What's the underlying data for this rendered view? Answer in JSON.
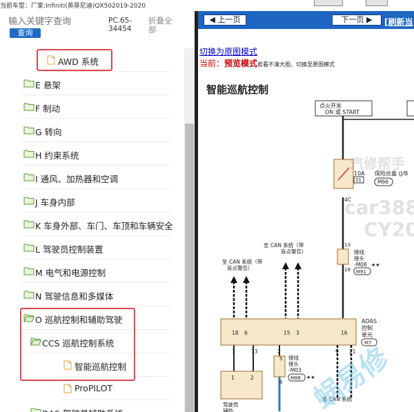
{
  "header": {
    "car_model": "当前车型：厂家:Infiniti(英菲尼迪)QX502019-2020"
  },
  "search": {
    "placeholder": "输入关键字查询",
    "button_label": "查询",
    "pc_code": "PC.65-34454",
    "collapse_all": "折叠全部"
  },
  "tree": {
    "items": [
      {
        "label": "AWD 系统",
        "icon": "document-icon",
        "type": "page"
      },
      {
        "label": "E 悬架",
        "icon": "folder-icon",
        "type": "folder"
      },
      {
        "label": "F 制动",
        "icon": "folder-icon",
        "type": "folder"
      },
      {
        "label": "G 转向",
        "icon": "folder-icon",
        "type": "folder"
      },
      {
        "label": "H 约束系统",
        "icon": "folder-icon",
        "type": "folder"
      },
      {
        "label": "I 通风、加热器和空调",
        "icon": "folder-icon",
        "type": "folder"
      },
      {
        "label": "J 车身内部",
        "icon": "folder-icon",
        "type": "folder"
      },
      {
        "label": "K 车身外部、车门、车顶和车辆安全",
        "icon": "folder-icon",
        "type": "folder"
      },
      {
        "label": "L 驾驶员控制装置",
        "icon": "folder-icon",
        "type": "folder"
      },
      {
        "label": "M 电气和电源控制",
        "icon": "folder-icon",
        "type": "folder"
      },
      {
        "label": "N 驾驶信息和多媒体",
        "icon": "folder-icon",
        "type": "folder"
      },
      {
        "label": "O 巡航控制和辅助驾驶",
        "icon": "folder-open-icon",
        "type": "folder-open"
      },
      {
        "label": "CCS 巡航控制系统",
        "icon": "folder-open-icon",
        "type": "folder-open"
      },
      {
        "label": "智能巡航控制",
        "icon": "document-icon",
        "type": "page"
      },
      {
        "label": "ProPILOT",
        "icon": "document-icon",
        "type": "page"
      },
      {
        "label": "DAS 驾驶员辅助系统",
        "icon": "folder-icon",
        "type": "folder"
      }
    ]
  },
  "viewer": {
    "prev_label": "上一页",
    "next_label": "下一页",
    "refresh_label": "[刷新当",
    "switch_link": "切换为原图模式",
    "current_prefix": "当前：",
    "current_mode": "预览模式",
    "current_hint": "若看不清大图，切换至原图模式",
    "doc_title": "智能巡航控制"
  },
  "diagram": {
    "ignition_label_1": "点火开关",
    "ignition_label_2": "ON 或 START",
    "fuse_amp": "10A",
    "fuse_no": "31",
    "fuse_box_1": "保险丝盒 (J/B",
    "fuse_box_2": "M66",
    "pin_4c": "4C",
    "can_top_1": "至 CAN 系统（带",
    "can_top_2": "盲点警告）",
    "can_left_1": "至 CAN 系统（带",
    "can_left_2": "盲点警告）",
    "junction_1": "接线",
    "junction_2": "接头",
    "junction_m08": "-M08",
    "junction_m91": "M91",
    "pin_13": "13",
    "pin_18": "18",
    "stars": "★★",
    "top_pins": [
      "18",
      "6",
      "15",
      "3",
      "16"
    ],
    "bottom_pins": [
      "1",
      "13",
      "2",
      "9",
      "21"
    ],
    "adas_1": "ADAS",
    "adas_2": "控制",
    "adas_3": "单元",
    "adas_conn": "M7",
    "junction_m03": "-M03",
    "junction_m86": "M86",
    "pin_5": "5",
    "pin_6": "6",
    "bottom_can": "至 CAN 系统",
    "bottom_pins_2": [
      "1",
      "2"
    ],
    "driver_1": "驾驶员",
    "driver_2": "辅助",
    "vertical_note": "驾驶辅助"
  },
  "watermark": {
    "line1": "汽修帮手",
    "line2": "car388",
    "line3": "CY20",
    "line4": "蜗易修"
  }
}
